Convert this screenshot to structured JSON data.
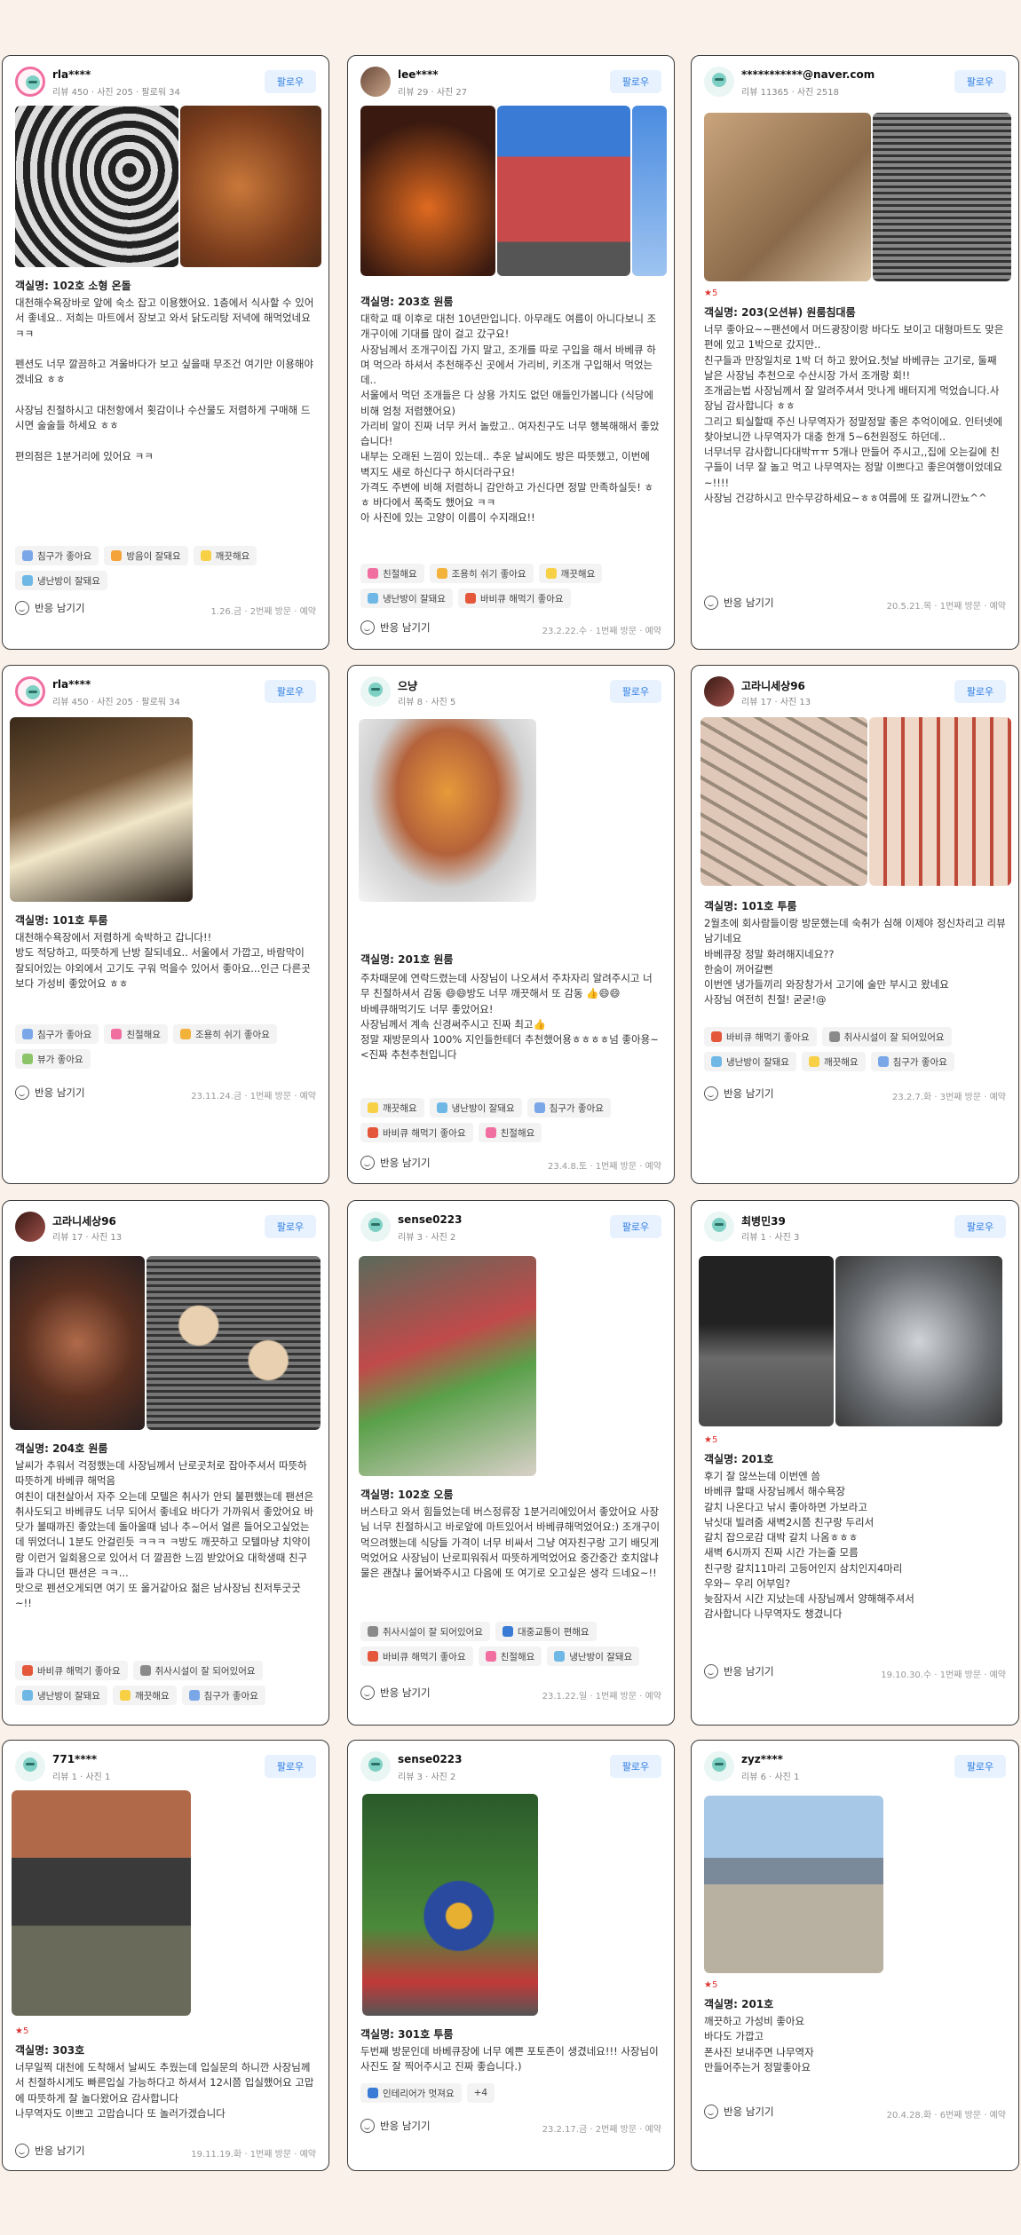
{
  "colors": {
    "follow_bg": "#e8f2ff",
    "follow_text": "#2f7de1",
    "star": "#e2313a",
    "card_border": "#3a3a3a",
    "page_bg": "#faf2ea"
  },
  "common": {
    "follow_label": "팔로우",
    "react_label": "반응 남기기"
  },
  "reviews": [
    {
      "user": "rla****",
      "stats": "리뷰 450 · 사진 205 · 팔로워 34",
      "room": "객실명: 102호 소형 온돌",
      "text": "대천해수욕장바로 앞에 숙소 잡고 이용했어요. 1층에서 식사할 수 있어서 좋네요.. 저희는 마트에서 장보고 와서 닭도리탕 저녁에 해먹었네요 ㅋㅋ\n\n펜션도 너무 깔끔하고 겨울바다가 보고 싶을때 무조건 여기만 이용해야 겠네요 ㅎㅎ\n\n사장님 친절하시고 대천항에서 횟감이나 수산물도 저렴하게 구매해 드시면 술술들 하세요 ㅎㅎ\n\n편의점은 1분거리에 있어요 ㅋㅋ",
      "tags": [
        "침구가 좋아요",
        "방음이 잘돼요",
        "깨끗해요",
        "냉난방이 잘돼요"
      ],
      "visit": "1.26.금 · 2번째 방문 · 예약"
    },
    {
      "user": "lee****",
      "stats": "리뷰 29 · 사진 27",
      "room": "객실명: 203호 원룸",
      "text": "대학교 때 이후로 대천 10년만입니다. 아무래도 여름이 아니다보니 조개구이에 기대를 많이 걸고 갔구요!\n사장님께서 조개구이집 가지 말고, 조개를 따로 구입을 해서 바베큐 하며 먹으라 하셔서 추천해주신 곳에서 가리비, 키조개 구입해서 먹었는데..\n서울에서 먹던 조개들은 다 상용 가치도 없던 애들인가봅니다 (식당에 비해 엄청 저렴했어요)\n가리비 알이 진짜 너무 커서 놀랐고.. 여자친구도 너무 행복해해서 좋았습니다!\n내부는 오래된 느낌이 있는데.. 추운 날씨에도 방은 따뜻했고, 이번에 벽지도 새로 하신다구 하시더라구요!\n가격도 주변에 비해 저렴하니 감안하고 가신다면 정말 만족하실듯! ㅎㅎ 바다에서 폭죽도 했어요 ㅋㅋ\n아 사진에 있는 고양이 이름이 수지래요!!",
      "tags": [
        "친절해요",
        "조용히 쉬기 좋아요",
        "깨끗해요",
        "냉난방이 잘돼요",
        "바비큐 해먹기 좋아요"
      ],
      "visit": "23.2.22.수 · 1번째 방문 · 예약"
    },
    {
      "user": "***********@naver.com",
      "stats": "리뷰 11365 · 사진 2518",
      "stars": "★5",
      "room": "객실명: 203(오션뷰) 원룸침대룸",
      "text": "너무 좋아요~~팬션에서 머드광장이랑 바다도 보이고 대형마트도 맞은편에 있고 1박으로 갔지만..\n친구들과 만장일치로 1박 더 하고 왔어요.첫날 바베큐는 고기로, 둘째날은 사장님 추천으로 수산시장 가서 조개랑 회!!\n조개굽는법 사장님께서 잘 알려주셔서 맛나게 배터지게 먹었습니다.사장님 감사합니다 ㅎㅎ\n그리고 퇴실할때 주신 나무역자가 정말정말 좋은 추억이에요. 인터넷에 찾아보니깐 나무역자가 대충 한개 5~6천원정도 하던데..\n너무너무 감사합니다대박ㅠㅠ 5개나 만들어 주시고,,집에 오는길에 친구들이 너무 잘 놀고 먹고 나무역자는 정말 이쁘다고 좋은여행이었데요~!!!!\n사장님 건강하시고 만수무강하세요~ㅎㅎ여름에 또 갈꺼니깐뇨^^",
      "tags": [],
      "visit": "20.5.21.목 · 1번째 방문 · 예약"
    },
    {
      "user": "rla****",
      "stats": "리뷰 450 · 사진 205 · 팔로워 34",
      "room": "객실명: 101호 투룸",
      "text": "대천해수욕장에서 저렴하게 숙박하고 갑니다!!\n방도 적당하고, 따뜻하게 난방 잘되네요.. 서울에서 가깝고, 바람막이 잘되어있는 야외에서 고기도 구워 먹을수 있어서 좋아요...인근 다른곳보다 가성비 좋았어요 ㅎㅎ",
      "tags": [
        "침구가 좋아요",
        "친절해요",
        "조용히 쉬기 좋아요",
        "뷰가 좋아요"
      ],
      "visit": "23.11.24.금 · 1번째 방문 · 예약"
    },
    {
      "user": "으냥",
      "stats": "리뷰 8 · 사진 5",
      "room": "객실명: 201호 원룸",
      "text": "주차때문에 연락드렸는데 사장님이 나오셔서 주차자리 알려주시고 너무 친절하셔서 감동 😄😄방도 너무 깨끗해서 또 감동 👍😄😄\n바베큐해먹기도 너무 좋았어요!\n사장님께서 계속 신경써주시고 진짜 최고👍\n정말 재방문의사 100% 지인들한테더 추천했어용ㅎㅎㅎㅎ넘 좋아용~ <진짜 추천추천입니다",
      "tags": [
        "깨끗해요",
        "냉난방이 잘돼요",
        "침구가 좋아요",
        "바비큐 해먹기 좋아요",
        "친절해요"
      ],
      "visit": "23.4.8.토 · 1번째 방문 · 예약"
    },
    {
      "user": "고라니세상96",
      "stats": "리뷰 17 · 사진 13",
      "room": "객실명: 101호 투룸",
      "text": "2월초에 회사람들이랑 방문했는데 숙취가 심해 이제야 정신차리고 리뷰 남기네요\n바베큐장 정말 화려해지네요??\n한숨이 꺼어갈뻔\n이번엔 냉가들끼리 와장창가서 고기에 술만 부시고 왔네요\n사장님 여전히 친절! 굳굳!@",
      "tags": [
        "바비큐 해먹기 좋아요",
        "취사시설이 잘 되어있어요",
        "냉난방이 잘돼요",
        "깨끗해요",
        "침구가 좋아요"
      ],
      "visit": "23.2.7.화 · 3번째 방문 · 예약"
    },
    {
      "user": "고라니세상96",
      "stats": "리뷰 17 · 사진 13",
      "room": "객실명: 204호 원룸",
      "text": "날씨가 추워서 걱정했는데 사장님께서 난로곳처로 잡아주셔서 따뜻하따뜻하게 바베큐 해먹음\n여친이 대천살아서 자주 오는데 모텔은 취사가 안되 불편했는데 팬션은 취사도되고 바베큐도 너무 되어서 좋네요 바다가 가까워서 좋았어요 바닷가 볼때까진 좋았는데 돌아올때 넘나 추~어서 얼른 들어오고싶었는데 뛰었더니 1분도 안걸린듯 ㅋㅋㅋ ㅋ방도 깨끗하고 모텔마냥 치약이랑 이런거 일회용으로 있어서 더 깔끔한 느낌 받았어요 대학생때 친구들과 다니던 팬션은 ㅋㅋ...\n맛으로 펜션오게되면 여기 또 올거같아요 젊은 남사장님 친저투굿굿~!!",
      "tags": [
        "바비큐 해먹기 좋아요",
        "취사시설이 잘 되어있어요",
        "냉난방이 잘돼요",
        "깨끗해요",
        "침구가 좋아요"
      ],
      "visit": ""
    },
    {
      "user": "sense0223",
      "stats": "리뷰 3 · 사진 2",
      "room": "객실명: 102호 오룸",
      "text": "버스타고 와서 힘들었는데 버스정류장 1분거리에있어서 좋았어요 사장님 너무 친절하시고 바로앞에 마트있어서 바베큐해먹었어요:) 조개구이 먹으려했는데 식당들 가격이 너무 비싸서 그냥 여자친구랑 고기 배딧게 먹었어요 사장님이 난로피워줘서 따뜻하게먹었어요 중간중간 호치않냐 물은 괜찮냐 물어봐주시고 다음에 또 여기로 오고싶은 생각 드네요~!!",
      "tags": [
        "취사시설이 잘 되어있어요",
        "대중교통이 편해요",
        "바비큐 해먹기 좋아요",
        "친절해요",
        "냉난방이 잘돼요"
      ],
      "visit": "23.1.22.일 · 1번째 방문 · 예약"
    },
    {
      "user": "최병민39",
      "stats": "리뷰 1 · 사진 3",
      "stars": "★5",
      "room": "객실명: 201호",
      "text": "후기 잘 않쓰는데 이번엔 씀\n바베큐 할때 사장님께서 해수욕장\n갈치 나온다고 낚시 좋아하면 가보라고\n낚싯대 빌려줌 새벽2시쯤 친구랑 두리서\n갈치 잡으로감 대박 갈치 나옴ㅎㅎㅎ\n새벽 6시까지 진짜 시간 가는줄 모름\n친구랑 갈치11마리 고등어인지 삼치인지4마리\n우와~ 우리 어부임?\n늦잠자서 시간 지났는데 사장님께서 양해해주셔서\n감사합니다 나무역자도 챙겼니다",
      "tags": [],
      "visit": "19.10.30.수 · 1번째 방문 · 예약"
    },
    {
      "user": "771****",
      "stats": "리뷰 1 · 사진 1",
      "stars": "★5",
      "room": "객실명: 303호",
      "text": "너무일찍 대천에 도착해서 날씨도 추웠는데 입실문의 하니깐 사장님께서 친절하시게도 빠른입실 가능하다고 하셔서 12시쯤 입실했어요 고맙에 따뜻하게 잘 놀다왔어요 감사합니다\n나무역자도 이쁘고 고맙습니다 또 놀러가겠습니다",
      "tags": [],
      "visit": "19.11.19.화 · 1번째 방문 · 예약"
    },
    {
      "user": "sense0223",
      "stats": "리뷰 3 · 사진 2",
      "room": "객실명: 301호 투룸",
      "text": "두번째 방문인데 바베큐장에 너무 예쁜 포토존이 생겼네요!!! 사장님이 사진도 잘 찍어주시고 진짜 좋습니다.)",
      "tags": [
        "인테리어가 멋져요",
        "+4"
      ],
      "visit": "23.2.17.금 · 2번째 방문 · 예약"
    },
    {
      "user": "zyz****",
      "stats": "리뷰 6 · 사진 1",
      "stars": "★5",
      "room": "객실명: 201호",
      "text": "깨끗하고 가성비 좋아요\n바다도 가깝고\n폰사진 보내주면 나무역자\n만들어주는거 정말좋아요",
      "tags": [],
      "visit": "20.4.28.화 · 6번째 방문 · 예약"
    }
  ]
}
